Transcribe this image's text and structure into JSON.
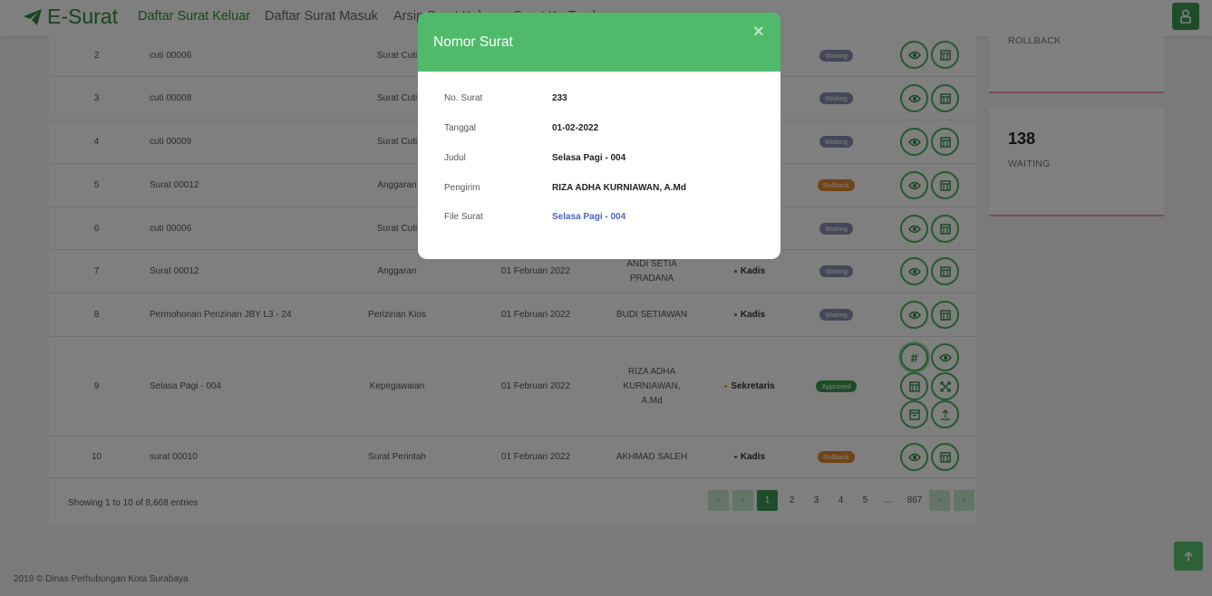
{
  "navbar": {
    "brand": "E-Surat",
    "links": [
      "Daftar Surat Keluar",
      "Daftar Surat Masuk",
      "Arsip Surat Keluar",
      "Surat Ke Tembusan"
    ]
  },
  "table": {
    "rows": [
      {
        "no": "2",
        "title": "cuti 00006",
        "category": "Surat Cuti",
        "date": "",
        "sender": "",
        "position": "",
        "status": "Waiting"
      },
      {
        "no": "3",
        "title": "cuti 00008",
        "category": "Surat Cuti",
        "date": "",
        "sender": "",
        "position": "",
        "status": "Waiting"
      },
      {
        "no": "4",
        "title": "cuti 00009",
        "category": "Surat Cuti",
        "date": "",
        "sender": "",
        "position": "",
        "status": "Waiting"
      },
      {
        "no": "5",
        "title": "Surat 00012",
        "category": "Anggaran",
        "date": "",
        "sender": "",
        "position": "",
        "status": "Rollback"
      },
      {
        "no": "6",
        "title": "cuti 00006",
        "category": "Surat Cuti",
        "date": "",
        "sender": "",
        "position": "",
        "status": "Waiting"
      },
      {
        "no": "7",
        "title": "Surat 00012",
        "category": "Anggaran",
        "date": "01 Februari 2022",
        "sender": "ANDI SETIA PRADANA",
        "position": "Kadis",
        "status": "Waiting"
      },
      {
        "no": "8",
        "title": "Permohonan Perizinan JBY L3 - 24",
        "category": "Perizinan Kios",
        "date": "01 Februari 2022",
        "sender": "BUDI SETIAWAN",
        "position": "Kadis",
        "status": "Waiting"
      },
      {
        "no": "9",
        "title": "Selasa Pagi - 004",
        "category": "Kepegawaian",
        "date": "01 Februari 2022",
        "sender": "RIZA ADHA KURNIAWAN, A.Md",
        "position": "Sekretaris",
        "status": "Approved"
      },
      {
        "no": "10",
        "title": "surat 00010",
        "category": "Surat Perintah",
        "date": "01 Februari 2022",
        "sender": "AKHMAD SALEH",
        "position": "Kadis",
        "status": "Rollback"
      }
    ],
    "showing": "Showing 1 to 10 of 8,668 entries",
    "pages": [
      "1",
      "2",
      "3",
      "4",
      "5",
      "...",
      "867"
    ]
  },
  "stats": [
    {
      "value": "",
      "label": "ROLLBACK"
    },
    {
      "value": "138",
      "label": "WAITING"
    }
  ],
  "footer": "2019 © Dinas Perhubungan Kota Surabaya",
  "modal": {
    "title": "Nomor Surat",
    "close": "×",
    "fields": [
      {
        "label": "No. Surat",
        "value": "233"
      },
      {
        "label": "Tanggal",
        "value": "01-02-2022"
      },
      {
        "label": "Judul",
        "value": "Selasa Pagi - 004"
      },
      {
        "label": "Pengirim",
        "value": "RIZA ADHA KURNIAWAN, A.Md"
      },
      {
        "label": "File Surat",
        "value": "Selasa Pagi - 004"
      }
    ]
  },
  "colors": {
    "brand": "#2e8b3e",
    "modal_header": "#4fba6a",
    "badge_waiting": "#8a8fb0",
    "badge_rollback": "#e0882a",
    "badge_approved": "#3a9a4a",
    "link": "#4a63c8"
  },
  "icons": {
    "brand": "paper-plane-icon",
    "user": "user-icon",
    "view": "eye-icon",
    "doc": "document-icon",
    "hash": "hash-icon",
    "expand": "expand-icon",
    "archive": "archive-icon",
    "upload": "upload-icon",
    "scroll_top": "arrow-up-icon"
  }
}
